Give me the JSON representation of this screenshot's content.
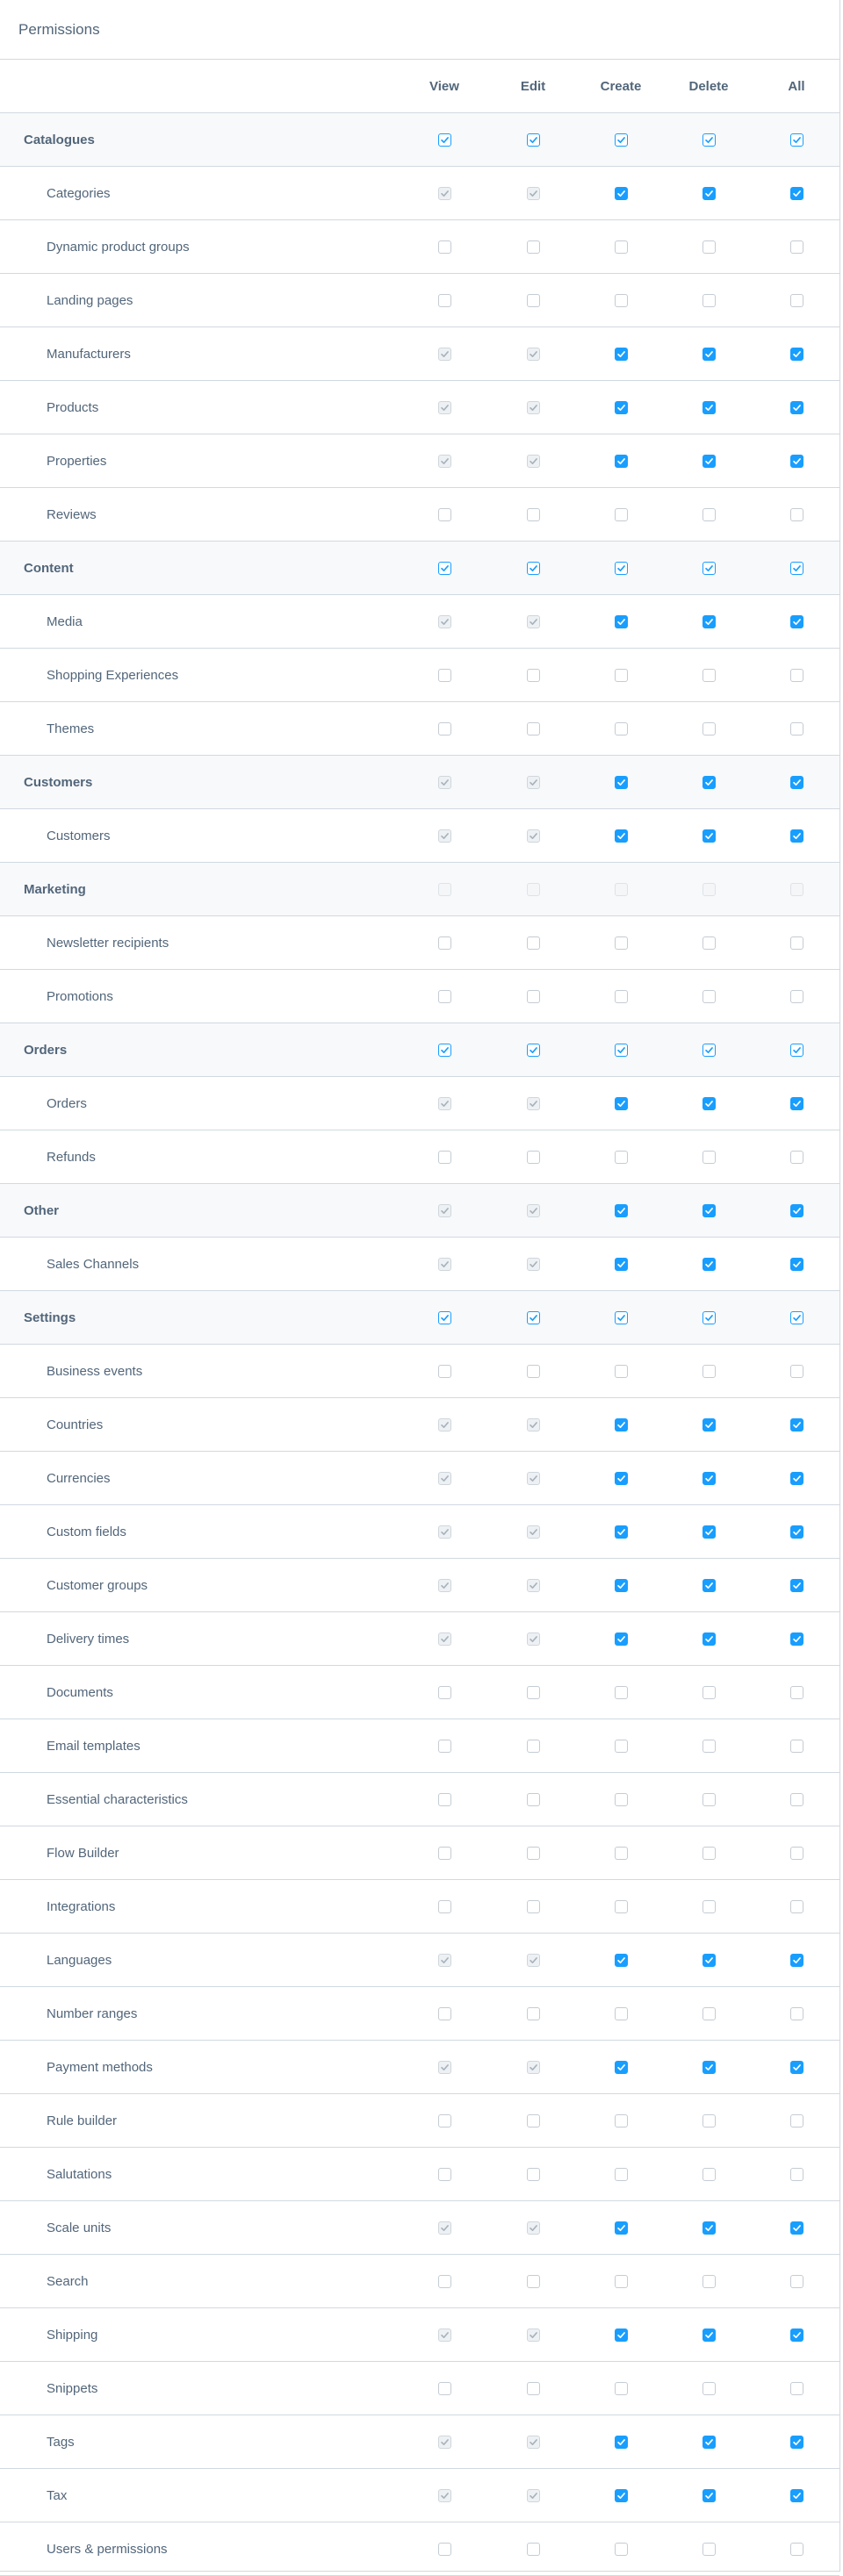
{
  "card": {
    "title": "Permissions"
  },
  "columns": [
    "View",
    "Edit",
    "Create",
    "Delete",
    "All"
  ],
  "colors": {
    "accent": "#189eff",
    "border": "#d1d9e0",
    "parent_row_bg": "#f8f9fb",
    "text": "#52667a"
  },
  "rows": [
    {
      "type": "parent",
      "label": "Catalogues",
      "states": [
        "outline",
        "outline",
        "outline",
        "outline",
        "outline"
      ]
    },
    {
      "type": "child",
      "label": "Categories",
      "states": [
        "disabled-checked",
        "disabled-checked",
        "checked",
        "checked",
        "checked"
      ]
    },
    {
      "type": "child",
      "label": "Dynamic product groups",
      "states": [
        "empty",
        "empty",
        "empty",
        "empty",
        "empty"
      ]
    },
    {
      "type": "child",
      "label": "Landing pages",
      "states": [
        "empty",
        "empty",
        "empty",
        "empty",
        "empty"
      ]
    },
    {
      "type": "child",
      "label": "Manufacturers",
      "states": [
        "disabled-checked",
        "disabled-checked",
        "checked",
        "checked",
        "checked"
      ]
    },
    {
      "type": "child",
      "label": "Products",
      "states": [
        "disabled-checked",
        "disabled-checked",
        "checked",
        "checked",
        "checked"
      ]
    },
    {
      "type": "child",
      "label": "Properties",
      "states": [
        "disabled-checked",
        "disabled-checked",
        "checked",
        "checked",
        "checked"
      ]
    },
    {
      "type": "child",
      "label": "Reviews",
      "states": [
        "empty",
        "empty",
        "empty",
        "empty",
        "empty"
      ]
    },
    {
      "type": "parent",
      "label": "Content",
      "states": [
        "outline",
        "outline",
        "outline",
        "outline",
        "outline"
      ]
    },
    {
      "type": "child",
      "label": "Media",
      "states": [
        "disabled-checked",
        "disabled-checked",
        "checked",
        "checked",
        "checked"
      ]
    },
    {
      "type": "child",
      "label": "Shopping Experiences",
      "states": [
        "empty",
        "empty",
        "empty",
        "empty",
        "empty"
      ]
    },
    {
      "type": "child",
      "label": "Themes",
      "states": [
        "empty",
        "empty",
        "empty",
        "empty",
        "empty"
      ]
    },
    {
      "type": "parent",
      "label": "Customers",
      "states": [
        "disabled-checked",
        "disabled-checked",
        "checked",
        "checked",
        "checked"
      ]
    },
    {
      "type": "child",
      "label": "Customers",
      "states": [
        "disabled-checked",
        "disabled-checked",
        "checked",
        "checked",
        "checked"
      ]
    },
    {
      "type": "parent",
      "label": "Marketing",
      "states": [
        "disabled",
        "disabled",
        "disabled",
        "disabled",
        "disabled"
      ]
    },
    {
      "type": "child",
      "label": "Newsletter recipients",
      "states": [
        "empty",
        "empty",
        "empty",
        "empty",
        "empty"
      ]
    },
    {
      "type": "child",
      "label": "Promotions",
      "states": [
        "empty",
        "empty",
        "empty",
        "empty",
        "empty"
      ]
    },
    {
      "type": "parent",
      "label": "Orders",
      "states": [
        "outline",
        "outline",
        "outline",
        "outline",
        "outline"
      ]
    },
    {
      "type": "child",
      "label": "Orders",
      "states": [
        "disabled-checked",
        "disabled-checked",
        "checked",
        "checked",
        "checked"
      ]
    },
    {
      "type": "child",
      "label": "Refunds",
      "states": [
        "empty",
        "empty",
        "empty",
        "empty",
        "empty"
      ]
    },
    {
      "type": "parent",
      "label": "Other",
      "states": [
        "disabled-checked",
        "disabled-checked",
        "checked",
        "checked",
        "checked"
      ]
    },
    {
      "type": "child",
      "label": "Sales Channels",
      "states": [
        "disabled-checked",
        "disabled-checked",
        "checked",
        "checked",
        "checked"
      ]
    },
    {
      "type": "parent",
      "label": "Settings",
      "states": [
        "outline",
        "outline",
        "outline",
        "outline",
        "outline"
      ]
    },
    {
      "type": "child",
      "label": "Business events",
      "states": [
        "empty",
        "empty",
        "empty",
        "empty",
        "empty"
      ]
    },
    {
      "type": "child",
      "label": "Countries",
      "states": [
        "disabled-checked",
        "disabled-checked",
        "checked",
        "checked",
        "checked"
      ]
    },
    {
      "type": "child",
      "label": "Currencies",
      "states": [
        "disabled-checked",
        "disabled-checked",
        "checked",
        "checked",
        "checked"
      ]
    },
    {
      "type": "child",
      "label": "Custom fields",
      "states": [
        "disabled-checked",
        "disabled-checked",
        "checked",
        "checked",
        "checked"
      ]
    },
    {
      "type": "child",
      "label": "Customer groups",
      "states": [
        "disabled-checked",
        "disabled-checked",
        "checked",
        "checked",
        "checked"
      ]
    },
    {
      "type": "child",
      "label": "Delivery times",
      "states": [
        "disabled-checked",
        "disabled-checked",
        "checked",
        "checked",
        "checked"
      ]
    },
    {
      "type": "child",
      "label": "Documents",
      "states": [
        "empty",
        "empty",
        "empty",
        "empty",
        "empty"
      ]
    },
    {
      "type": "child",
      "label": "Email templates",
      "states": [
        "empty",
        "empty",
        "empty",
        "empty",
        "empty"
      ]
    },
    {
      "type": "child",
      "label": "Essential characteristics",
      "states": [
        "empty",
        "empty",
        "empty",
        "empty",
        "empty"
      ]
    },
    {
      "type": "child",
      "label": "Flow Builder",
      "states": [
        "empty",
        "empty",
        "empty",
        "empty",
        "empty"
      ]
    },
    {
      "type": "child",
      "label": "Integrations",
      "states": [
        "empty",
        "empty",
        "empty",
        "empty",
        "empty"
      ]
    },
    {
      "type": "child",
      "label": "Languages",
      "states": [
        "disabled-checked",
        "disabled-checked",
        "checked",
        "checked",
        "checked"
      ]
    },
    {
      "type": "child",
      "label": "Number ranges",
      "states": [
        "empty",
        "empty",
        "empty",
        "empty",
        "empty"
      ]
    },
    {
      "type": "child",
      "label": "Payment methods",
      "states": [
        "disabled-checked",
        "disabled-checked",
        "checked",
        "checked",
        "checked"
      ]
    },
    {
      "type": "child",
      "label": "Rule builder",
      "states": [
        "empty",
        "empty",
        "empty",
        "empty",
        "empty"
      ]
    },
    {
      "type": "child",
      "label": "Salutations",
      "states": [
        "empty",
        "empty",
        "empty",
        "empty",
        "empty"
      ]
    },
    {
      "type": "child",
      "label": "Scale units",
      "states": [
        "disabled-checked",
        "disabled-checked",
        "checked",
        "checked",
        "checked"
      ]
    },
    {
      "type": "child",
      "label": "Search",
      "states": [
        "empty",
        "empty",
        "empty",
        "empty",
        "empty"
      ]
    },
    {
      "type": "child",
      "label": "Shipping",
      "states": [
        "disabled-checked",
        "disabled-checked",
        "checked",
        "checked",
        "checked"
      ]
    },
    {
      "type": "child",
      "label": "Snippets",
      "states": [
        "empty",
        "empty",
        "empty",
        "empty",
        "empty"
      ]
    },
    {
      "type": "child",
      "label": "Tags",
      "states": [
        "disabled-checked",
        "disabled-checked",
        "checked",
        "checked",
        "checked"
      ]
    },
    {
      "type": "child",
      "label": "Tax",
      "states": [
        "disabled-checked",
        "disabled-checked",
        "checked",
        "checked",
        "checked"
      ]
    },
    {
      "type": "child",
      "label": "Users & permissions",
      "states": [
        "empty",
        "empty",
        "empty",
        "empty",
        "empty"
      ]
    }
  ]
}
